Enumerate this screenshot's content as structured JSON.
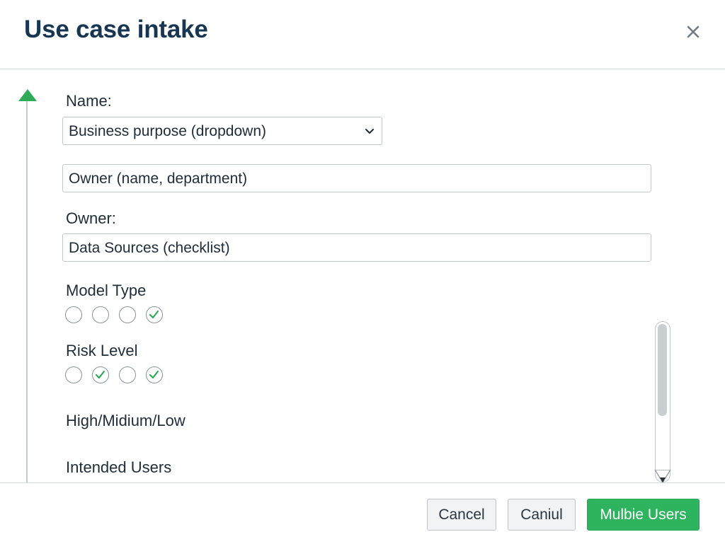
{
  "dialog": {
    "title": "Use case intake",
    "close_icon": "close-icon"
  },
  "form": {
    "name_label": "Name:",
    "business_purpose": {
      "value": "Business purpose (dropdown)",
      "icon": "chevron-down-icon"
    },
    "owner_field": {
      "value": "Owner (name, department)"
    },
    "owner_label": "Owner:",
    "data_sources": {
      "value": "Data Sources (checklist)"
    },
    "model_type": {
      "label": "Model Type",
      "options_checked": [
        false,
        false,
        false,
        true
      ]
    },
    "risk_level": {
      "label": "Risk Level",
      "options_checked": [
        false,
        true,
        false,
        true
      ],
      "note": "High/Midium/Low"
    },
    "intended_users_label": "Intended Users"
  },
  "footer": {
    "cancel_label": "Cancel",
    "second_label": "Caniul",
    "primary_label": "Mulbie Users"
  },
  "colors": {
    "title": "#173652",
    "accent_green": "#2eb45f",
    "check_green": "#2eaa57",
    "border": "#c1c8ce"
  }
}
